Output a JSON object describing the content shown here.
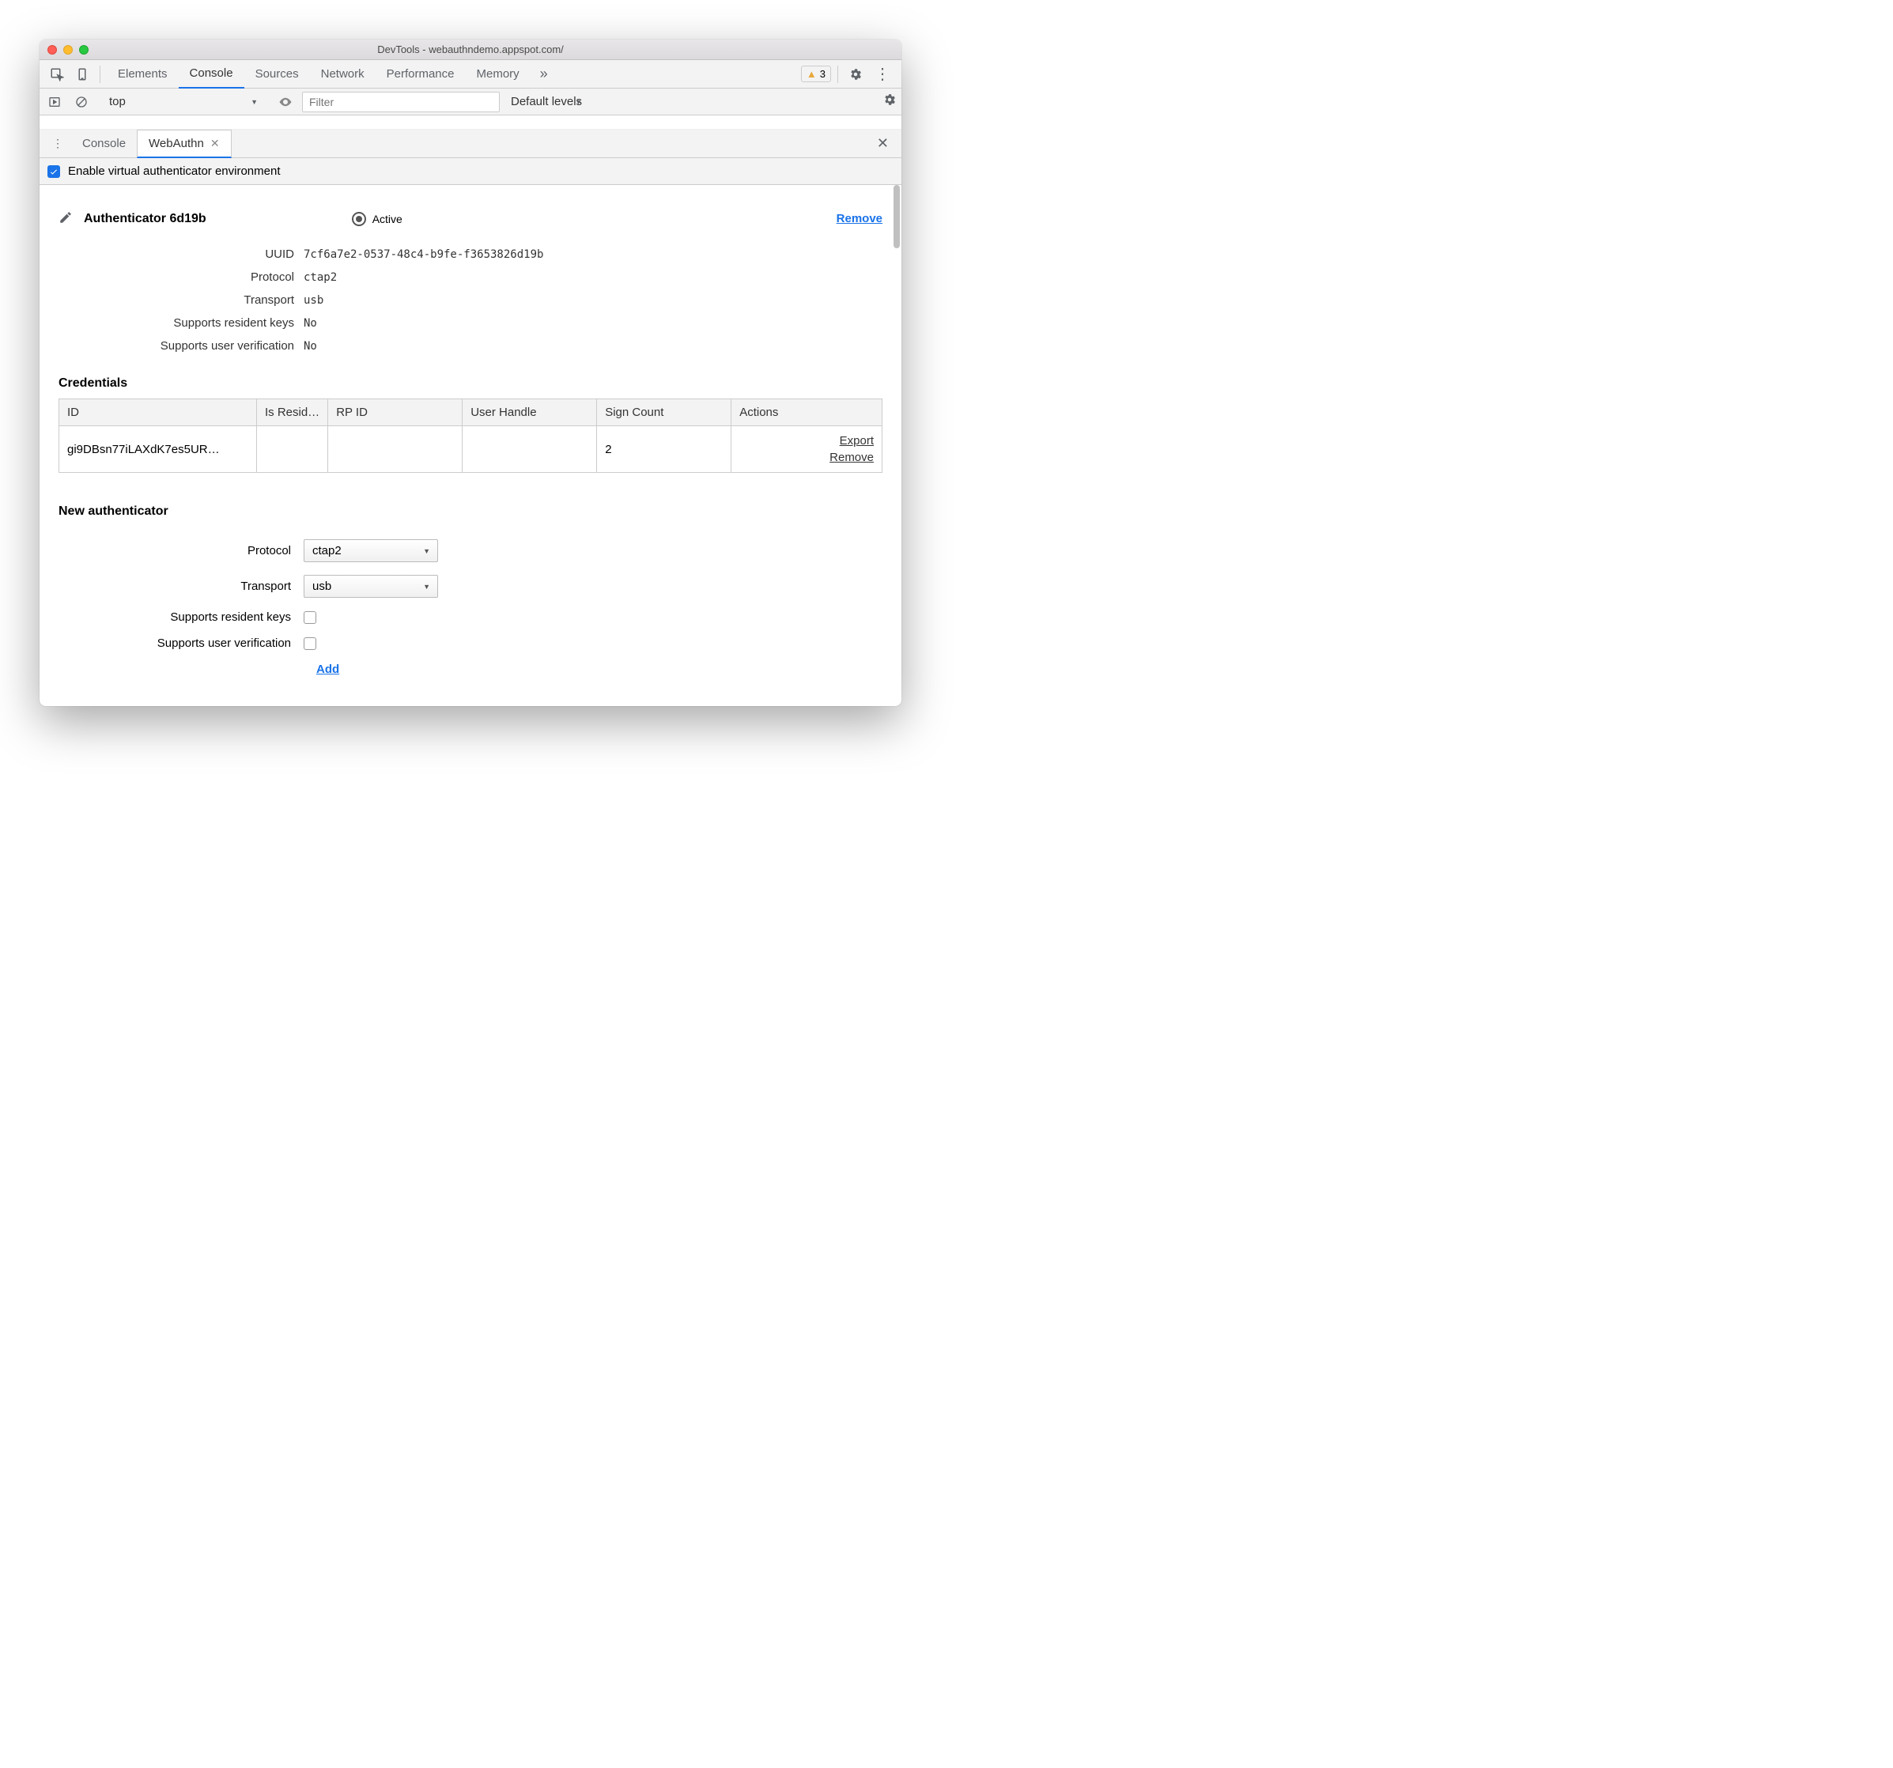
{
  "titlebar": "DevTools - webauthndemo.appspot.com/",
  "mainTabs": {
    "elements": "Elements",
    "console": "Console",
    "sources": "Sources",
    "network": "Network",
    "performance": "Performance",
    "memory": "Memory"
  },
  "warningCount": "3",
  "consoleBar": {
    "context": "top",
    "filterPlaceholder": "Filter",
    "levels": "Default levels"
  },
  "drawerTabs": {
    "console": "Console",
    "webauthn": "WebAuthn"
  },
  "enableLabel": "Enable virtual authenticator environment",
  "authenticator": {
    "title": "Authenticator 6d19b",
    "activeLabel": "Active",
    "removeLabel": "Remove",
    "props": {
      "uuid_label": "UUID",
      "uuid": "7cf6a7e2-0537-48c4-b9fe-f3653826d19b",
      "protocol_label": "Protocol",
      "protocol": "ctap2",
      "transport_label": "Transport",
      "transport": "usb",
      "resident_label": "Supports resident keys",
      "resident": "No",
      "userver_label": "Supports user verification",
      "userver": "No"
    }
  },
  "credentials": {
    "heading": "Credentials",
    "headers": {
      "id": "ID",
      "resident": "Is Resid…",
      "rpid": "RP ID",
      "userHandle": "User Handle",
      "signCount": "Sign Count",
      "actions": "Actions"
    },
    "row": {
      "id": "gi9DBsn77iLAXdK7es5UR…",
      "resident": "",
      "rpid": "",
      "userHandle": "",
      "signCount": "2",
      "export": "Export",
      "remove": "Remove"
    }
  },
  "newAuth": {
    "heading": "New authenticator",
    "protocolLabel": "Protocol",
    "protocolValue": "ctap2",
    "transportLabel": "Transport",
    "transportValue": "usb",
    "residentLabel": "Supports resident keys",
    "userverLabel": "Supports user verification",
    "addLabel": "Add"
  }
}
